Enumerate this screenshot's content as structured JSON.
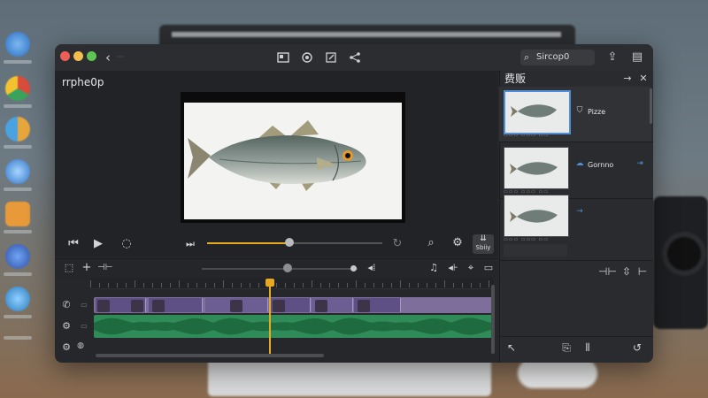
{
  "window": {
    "title": "",
    "nav_back": "‹",
    "nav_forward": "···"
  },
  "toolbar": {
    "icons": [
      "layout-icon",
      "camera-icon",
      "edit-icon",
      "share-icon"
    ]
  },
  "search": {
    "text": "Sircop0"
  },
  "viewer": {
    "project_title": "rrphe0p",
    "playback_progress": 0.47
  },
  "controls": {
    "export_label": "Sbiiy"
  },
  "timeline": {
    "zoom_level": 0.55,
    "playhead_position": 0.44
  },
  "panel": {
    "title": "费贩",
    "items": [
      {
        "label": "Pizze",
        "icon": "shield-icon",
        "selected": true
      },
      {
        "label": "Gornno",
        "icon": "cloud-icon",
        "selected": false
      },
      {
        "label": "",
        "icon": "arrow-icon",
        "selected": false
      }
    ]
  },
  "colors": {
    "accent": "#e7a920",
    "selection": "#4f8fd8",
    "video_track": "#7d6e9b",
    "audio_track": "#2f8c58"
  }
}
